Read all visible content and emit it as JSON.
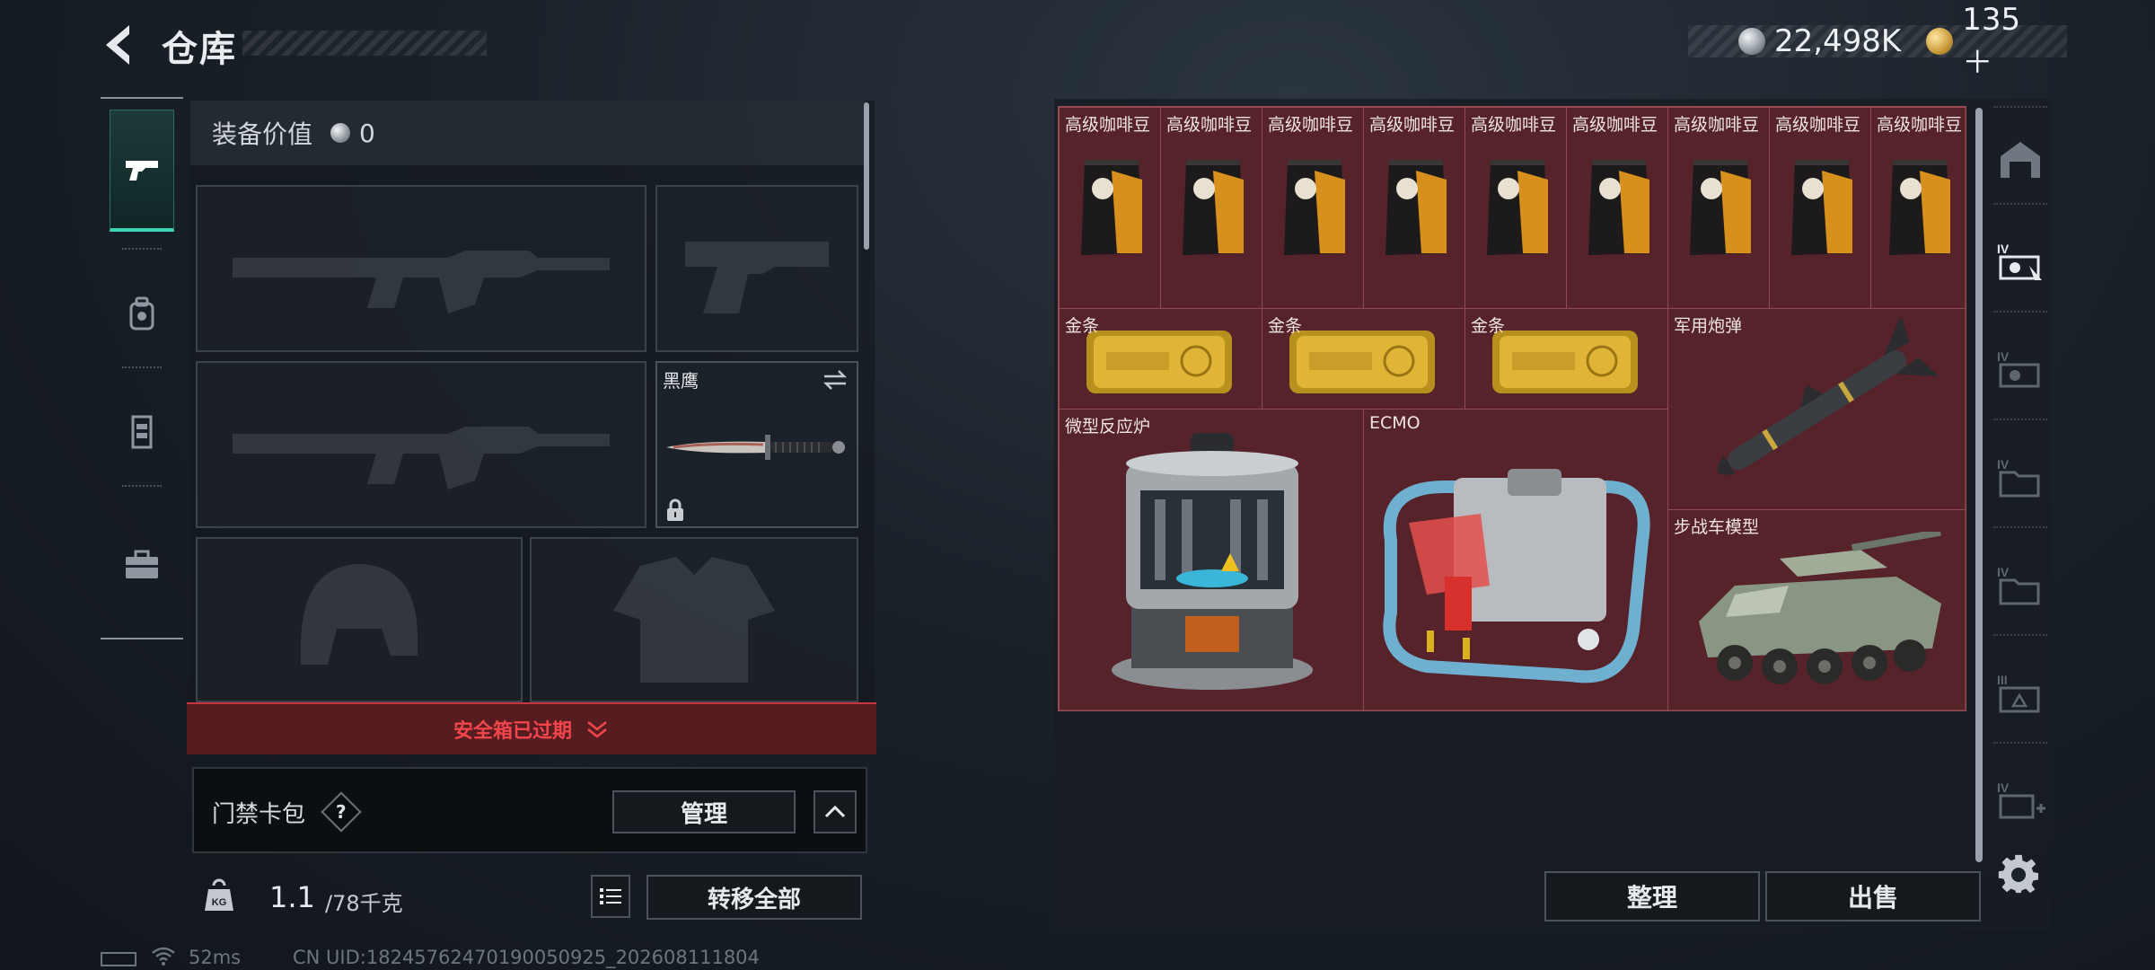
{
  "header": {
    "title": "仓库",
    "currency": [
      {
        "icon": "silver-coin-icon",
        "value": "22,498K"
      },
      {
        "icon": "gold-coin-icon",
        "value": "135＋"
      }
    ]
  },
  "tabs": [
    {
      "name": "weapon-tab",
      "icon": "pistol-icon",
      "active": true
    },
    {
      "name": "backpack-tab",
      "icon": "backpack-icon",
      "active": false
    },
    {
      "name": "vest-tab",
      "icon": "vest-icon",
      "active": false
    },
    {
      "name": "case-tab",
      "icon": "briefcase-icon",
      "active": false
    }
  ],
  "equipment": {
    "value_label": "装备价值",
    "value": "0",
    "melee_slot_label": "黑鹰"
  },
  "safe_box": {
    "label": "安全箱已过期"
  },
  "card_pack": {
    "label": "门禁卡包",
    "help": "?",
    "manage": "管理"
  },
  "weight": {
    "current": "1.1",
    "max": "/78千克",
    "kg_icon": "KG"
  },
  "transfer_all": "转移全部",
  "footer": {
    "ping": "52ms",
    "uid": "CN UID:18245762470190050925_202608111804"
  },
  "storage": {
    "items": [
      {
        "label": "高级咖啡豆",
        "kind": "coffee"
      },
      {
        "label": "高级咖啡豆",
        "kind": "coffee"
      },
      {
        "label": "高级咖啡豆",
        "kind": "coffee"
      },
      {
        "label": "高级咖啡豆",
        "kind": "coffee"
      },
      {
        "label": "高级咖啡豆",
        "kind": "coffee"
      },
      {
        "label": "高级咖啡豆",
        "kind": "coffee"
      },
      {
        "label": "高级咖啡豆",
        "kind": "coffee"
      },
      {
        "label": "高级咖啡豆",
        "kind": "coffee"
      },
      {
        "label": "高级咖啡豆",
        "kind": "coffee"
      },
      {
        "label": "金条",
        "kind": "gold-bar"
      },
      {
        "label": "金条",
        "kind": "gold-bar"
      },
      {
        "label": "金条",
        "kind": "gold-bar"
      },
      {
        "label": "军用炮弹",
        "kind": "missile"
      },
      {
        "label": "微型反应炉",
        "kind": "reactor"
      },
      {
        "label": "ECMO",
        "kind": "ecmo"
      },
      {
        "label": "步战车模型",
        "kind": "ifv-model"
      }
    ],
    "sort": "整理",
    "sell": "出售"
  },
  "colors": {
    "accent_teal": "#3dd6b4",
    "alert_red": "#f2454c",
    "storage_bg": "#4a1f25"
  }
}
